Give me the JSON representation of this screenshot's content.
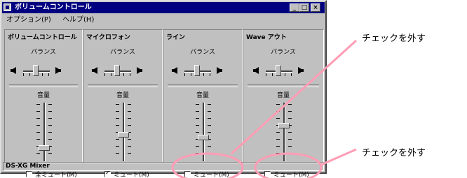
{
  "window": {
    "title": "ボリュームコントロール",
    "controls": {
      "minimize": "_",
      "maximize": "□",
      "close": "×"
    }
  },
  "menu": [
    "オプション(P)",
    "ヘルプ(H)"
  ],
  "panels": [
    {
      "title": "ボリュームコントロール",
      "balance_label": "バランス",
      "volume_label": "音量",
      "volume_level_pct": 20,
      "mute_label": "全ミュート(M)",
      "mute_checked": false
    },
    {
      "title": "マイクロフォン",
      "balance_label": "バランス",
      "volume_label": "音量",
      "volume_level_pct": 45,
      "mute_label": "ミュート(M)",
      "mute_checked": true
    },
    {
      "title": "ライン",
      "balance_label": "バランス",
      "volume_label": "音量",
      "volume_level_pct": 40,
      "mute_label": "ミュート(M)",
      "mute_checked": false
    },
    {
      "title": "Wave アウト",
      "balance_label": "バランス",
      "volume_label": "音量",
      "volume_level_pct": 62,
      "mute_label": "ミュート(M)",
      "mute_checked": false
    }
  ],
  "status": "DS-XG Mixer",
  "annotations": [
    "チェックを外す",
    "チェックを外す"
  ],
  "colors": {
    "window_face": "#c0c0c0",
    "titlebar": "#000080",
    "highlight": "#ff9db5"
  }
}
